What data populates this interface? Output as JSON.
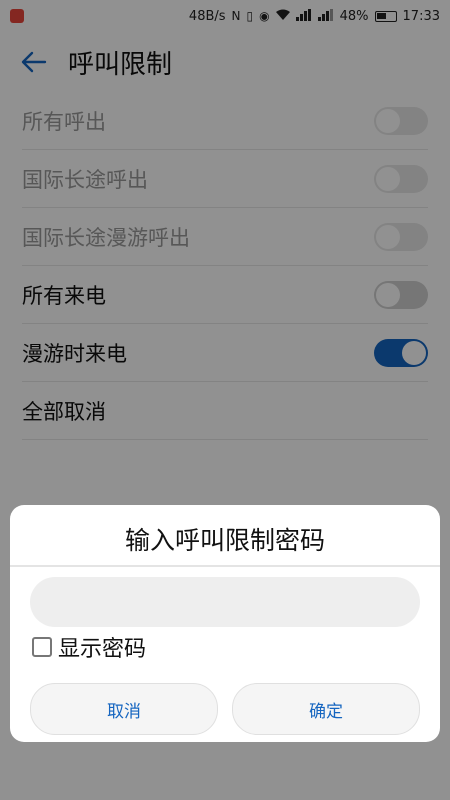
{
  "status_bar": {
    "speed": "48B/s",
    "battery_percent": "48%",
    "time": "17:33",
    "icons": [
      "nfc-icon",
      "vibrate-icon",
      "eye-comfort-icon",
      "wifi-icon",
      "signal-4g-icon",
      "signal-3g-icon"
    ]
  },
  "header": {
    "title": "呼叫限制",
    "back_icon": "back-arrow-icon"
  },
  "settings": {
    "items": [
      {
        "label": "所有呼出",
        "enabled": false,
        "on": false
      },
      {
        "label": "国际长途呼出",
        "enabled": false,
        "on": false
      },
      {
        "label": "国际长途漫游呼出",
        "enabled": false,
        "on": false
      },
      {
        "label": "所有来电",
        "enabled": true,
        "on": false
      },
      {
        "label": "漫游时来电",
        "enabled": true,
        "on": true
      },
      {
        "label": "全部取消",
        "enabled": true
      }
    ]
  },
  "dialog": {
    "title": "输入呼叫限制密码",
    "password_value": "",
    "password_placeholder": "",
    "show_password_label": "显示密码",
    "show_password_checked": false,
    "cancel_label": "取消",
    "confirm_label": "确定"
  },
  "colors": {
    "accent": "#1565c0",
    "dim_overlay": "#000000",
    "switch_off": "#cfcfcf"
  },
  "nav_bar": {
    "icons": [
      "nav-back-icon",
      "nav-home-icon",
      "nav-recents-icon"
    ]
  }
}
